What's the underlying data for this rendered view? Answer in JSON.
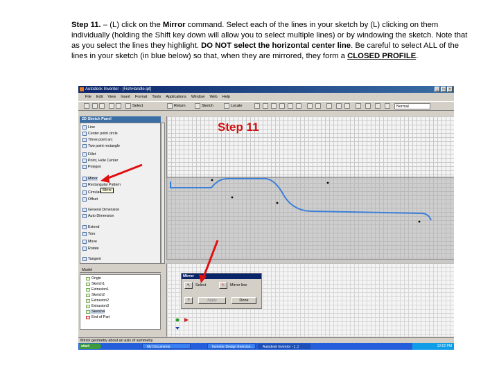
{
  "instructions": {
    "step": "Step 11.",
    "text1": " – (L) click on the ",
    "mirror_word": "Mirror",
    "text2": " command. Select each of the lines in your sketch by (L) clicking on them individually (holding the Shift key down will allow you to select multiple lines) or by windowing the sketch. Note that as you select the lines they highlight. ",
    "bold_warning": "DO NOT select the horizontal center line",
    "text3": ". Be careful to select ALL of the lines in your sketch (in blue below) so that, when they are mirrored, they form a ",
    "closed_profile": "CLOSED PROFILE",
    "text4": "."
  },
  "overlay": {
    "step_label": "Step 11",
    "arrow_color": "#e01010"
  },
  "app": {
    "title": "Autodesk Inventor - [FishHandle.ipt]",
    "menus": [
      "File",
      "Edit",
      "View",
      "Insert",
      "Format",
      "Tools",
      "Applications",
      "Window",
      "Web",
      "Help"
    ],
    "toolbar": {
      "select_label": "Select",
      "return_label": "Return",
      "sketch_label": "Sketch",
      "locate_label": "Locate",
      "style_value": "Normal"
    },
    "panel": {
      "header": "2D Sketch Panel",
      "items": [
        "Line",
        "Center point circle",
        "Three point arc",
        "Two point rectangle",
        "Fillet",
        "Point, Hole Center",
        "Polygon",
        "Mirror",
        "Rectangular Pattern",
        "Circular Pattern",
        "Offset",
        "General Dimension",
        "Auto Dimension",
        "Extend",
        "Trim",
        "Move",
        "Rotate",
        "Tangent"
      ],
      "tooltip": "Mirror"
    },
    "browser": {
      "header": "Model",
      "items": [
        "Origin",
        "Sketch1",
        "Extrusion1",
        "Sketch2",
        "Extrusion2",
        "Extrusion3",
        "Sketch4",
        "End of Part"
      ]
    },
    "dialog": {
      "title": "Mirror",
      "select_label": "Select",
      "mirror_line_label": "Mirror line",
      "apply_label": "Apply",
      "done_label": "Done"
    },
    "status": "Mirror geometry about an axis of symmetry",
    "taskbar": {
      "start": "start",
      "tasks": [
        "My Documents",
        "Inventor Design Exercise...",
        "Autodesk Inventor - [...]"
      ],
      "clock": "12:52 PM"
    }
  }
}
